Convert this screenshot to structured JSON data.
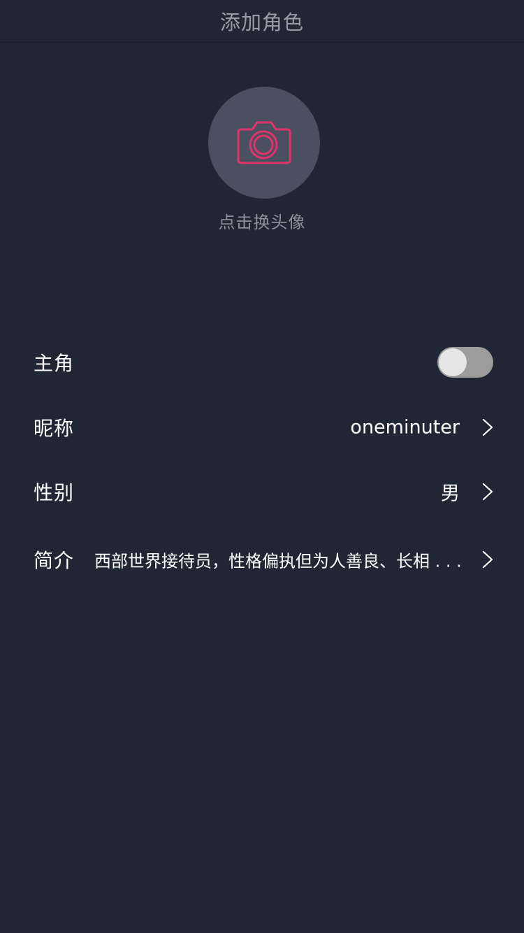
{
  "header": {
    "title": "添加角色"
  },
  "avatar": {
    "icon": "camera-icon",
    "icon_color": "#e0336e",
    "hint": "点击换头像"
  },
  "rows": {
    "protagonist": {
      "label": "主角",
      "toggle_on": false
    },
    "nickname": {
      "label": "昵称",
      "value": "oneminuter"
    },
    "gender": {
      "label": "性别",
      "value": "男"
    },
    "intro": {
      "label": "简介",
      "value": "西部世界接待员，性格偏执但为人善良、长相 . . ."
    }
  },
  "colors": {
    "background": "#212635",
    "avatar_circle": "#4a5060",
    "toggle_track": "#9c9c9c",
    "toggle_knob": "#e6e6e6"
  }
}
